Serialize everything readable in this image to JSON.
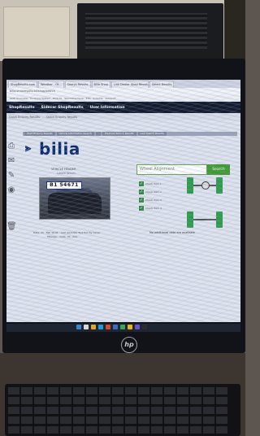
{
  "browser": {
    "tabs": [
      "ShopResults.com",
      "Weather - Ot...",
      "Search Results",
      "Bilia Shop",
      "Link Dealer Shop Results",
      "Select Results"
    ],
    "url": "bilia.shopresults.se/shop/search",
    "bookmarks": "GMR Overview  ·  Forsberg System  ·  Bilia.AS  ·  Serviceterminal  ·  ESR  ·  Schema  ·  Autoport"
  },
  "app": {
    "nav": [
      "ShopResults",
      "Sidecar ShopResults",
      "User Information"
    ],
    "subnav": [
      "Quick Enquiry Results",
      "Quick Enquiry Results"
    ],
    "breadcrumbs": [
      "Start Enquiry Results",
      "Vehicle Information Search",
      "",
      "Previous Search Results",
      "Last Search Results"
    ]
  },
  "brand": {
    "name": "bilia",
    "color": "#0b2a6b"
  },
  "search": {
    "placeholder": "Wheel Alignment",
    "button": "Search"
  },
  "vehicle": {
    "title": "VEHICLE HEADER",
    "subtitle": "Lorem ipsum",
    "plate": "B1 54671"
  },
  "checklist": [
    "Check item 1",
    "Check item 2",
    "Check item 3",
    "Check item 4"
  ],
  "footer": {
    "line1": "Date: 21 · Feb 10:01 · Last recorded Test Tool by owner",
    "line2": "Mileage: · Date: 09 · Req",
    "nodata": "No additional data are available"
  },
  "colors": {
    "accent_green": "#3f9b2e",
    "navbar": "#121a2c"
  },
  "device": {
    "monitor_brand": "hp"
  }
}
